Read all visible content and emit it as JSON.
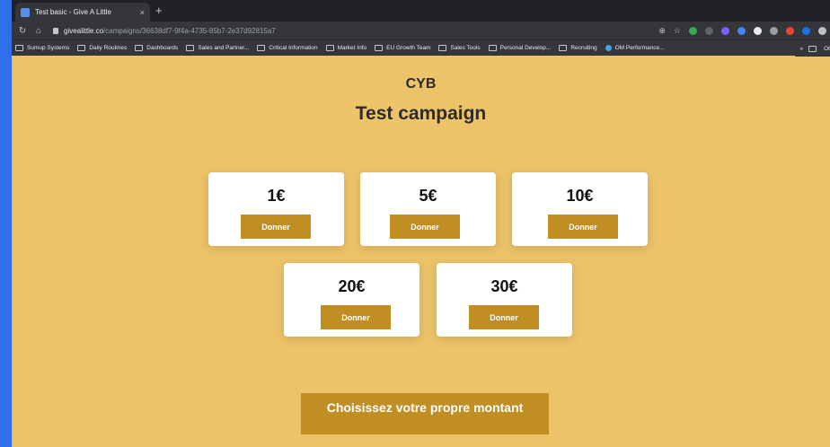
{
  "browser": {
    "tab_title": "Test basic - Give A Little",
    "tab_close": "×",
    "new_tab": "+",
    "url_domain": "givealittle.co",
    "url_path": "/campaigns/36638df7-9f4a-4735-85b7-2e37d92815a7",
    "bookmarks": [
      "Sumup Systems",
      "Daily Routines",
      "Dashboards",
      "Sales and Partner...",
      "Critical Information",
      "Market Info",
      "EU Growth Team",
      "Sales Tools",
      "Personal Develop...",
      "Recruiting",
      "OM Performance..."
    ],
    "bookmarks_overflow": "»",
    "other_bookmarks": "Ot"
  },
  "page": {
    "org_name": "CYB",
    "campaign_title": "Test campaign",
    "donations": [
      {
        "amount": "1€",
        "button": "Donner"
      },
      {
        "amount": "5€",
        "button": "Donner"
      },
      {
        "amount": "10€",
        "button": "Donner"
      },
      {
        "amount": "20€",
        "button": "Donner"
      },
      {
        "amount": "30€",
        "button": "Donner"
      }
    ],
    "custom_amount_button": "Choisissez votre propre montant"
  },
  "colors": {
    "page_background": "#ecc369",
    "button": "#c08e22",
    "card": "#ffffff",
    "frame": "#2f6fea"
  }
}
